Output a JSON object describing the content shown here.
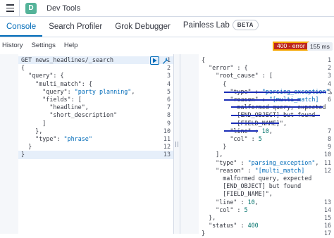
{
  "header": {
    "avatar_letter": "D",
    "title": "Dev Tools"
  },
  "tabs": [
    {
      "label": "Console"
    },
    {
      "label": "Search Profiler"
    },
    {
      "label": "Grok Debugger"
    },
    {
      "label": "Painless Lab",
      "badge": "BETA"
    }
  ],
  "toolbar": {
    "history": "History",
    "settings": "Settings",
    "help": "Help"
  },
  "response_status": {
    "code": "400 - error",
    "time": "155 ms"
  },
  "request_lines": [
    {
      "n": "1",
      "text": "GET news_headlines/_search"
    },
    {
      "n": "2",
      "text": "{"
    },
    {
      "n": "3",
      "text": "  \"query\": {"
    },
    {
      "n": "4",
      "text": "    \"multi_match\": {"
    },
    {
      "n": "5",
      "text": "      \"query\": \"party planning\","
    },
    {
      "n": "6",
      "text": "      \"fields\": ["
    },
    {
      "n": "7",
      "text": "        \"headline\","
    },
    {
      "n": "8",
      "text": "        \"short_description\""
    },
    {
      "n": "9",
      "text": "      ]"
    },
    {
      "n": "10",
      "text": "    },"
    },
    {
      "n": "11",
      "text": "    \"type\": \"phrase\""
    },
    {
      "n": "12",
      "text": "  }"
    },
    {
      "n": "13",
      "text": "}"
    }
  ],
  "response_lines": [
    {
      "n": "1",
      "text": "{"
    },
    {
      "n": "2",
      "text": "  \"error\" : {"
    },
    {
      "n": "3",
      "text": "    \"root_cause\" : ["
    },
    {
      "n": "4",
      "text": "      {"
    },
    {
      "n": "5",
      "text": "        \"type\" : \"parsing_exception\","
    },
    {
      "n": "6",
      "text": "        \"reason\" : \"[multi_match]"
    },
    {
      "n": "",
      "text": "          malformed query, expected"
    },
    {
      "n": "",
      "text": "          [END_OBJECT] but found"
    },
    {
      "n": "",
      "text": "          [FIELD_NAME]\","
    },
    {
      "n": "7",
      "text": "        \"line\" : 10,"
    },
    {
      "n": "8",
      "text": "        \"col\" : 5"
    },
    {
      "n": "9",
      "text": "      }"
    },
    {
      "n": "10",
      "text": "    ],"
    },
    {
      "n": "11",
      "text": "    \"type\" : \"parsing_exception\","
    },
    {
      "n": "12",
      "text": "    \"reason\" : \"[multi_match]"
    },
    {
      "n": "",
      "text": "      malformed query, expected"
    },
    {
      "n": "",
      "text": "      [END_OBJECT] but found"
    },
    {
      "n": "",
      "text": "      [FIELD_NAME]\","
    },
    {
      "n": "13",
      "text": "    \"line\" : 10,"
    },
    {
      "n": "14",
      "text": "    \"col\" : 5"
    },
    {
      "n": "15",
      "text": "  },"
    },
    {
      "n": "16",
      "text": "  \"status\" : 400"
    },
    {
      "n": "17",
      "text": "}"
    }
  ]
}
